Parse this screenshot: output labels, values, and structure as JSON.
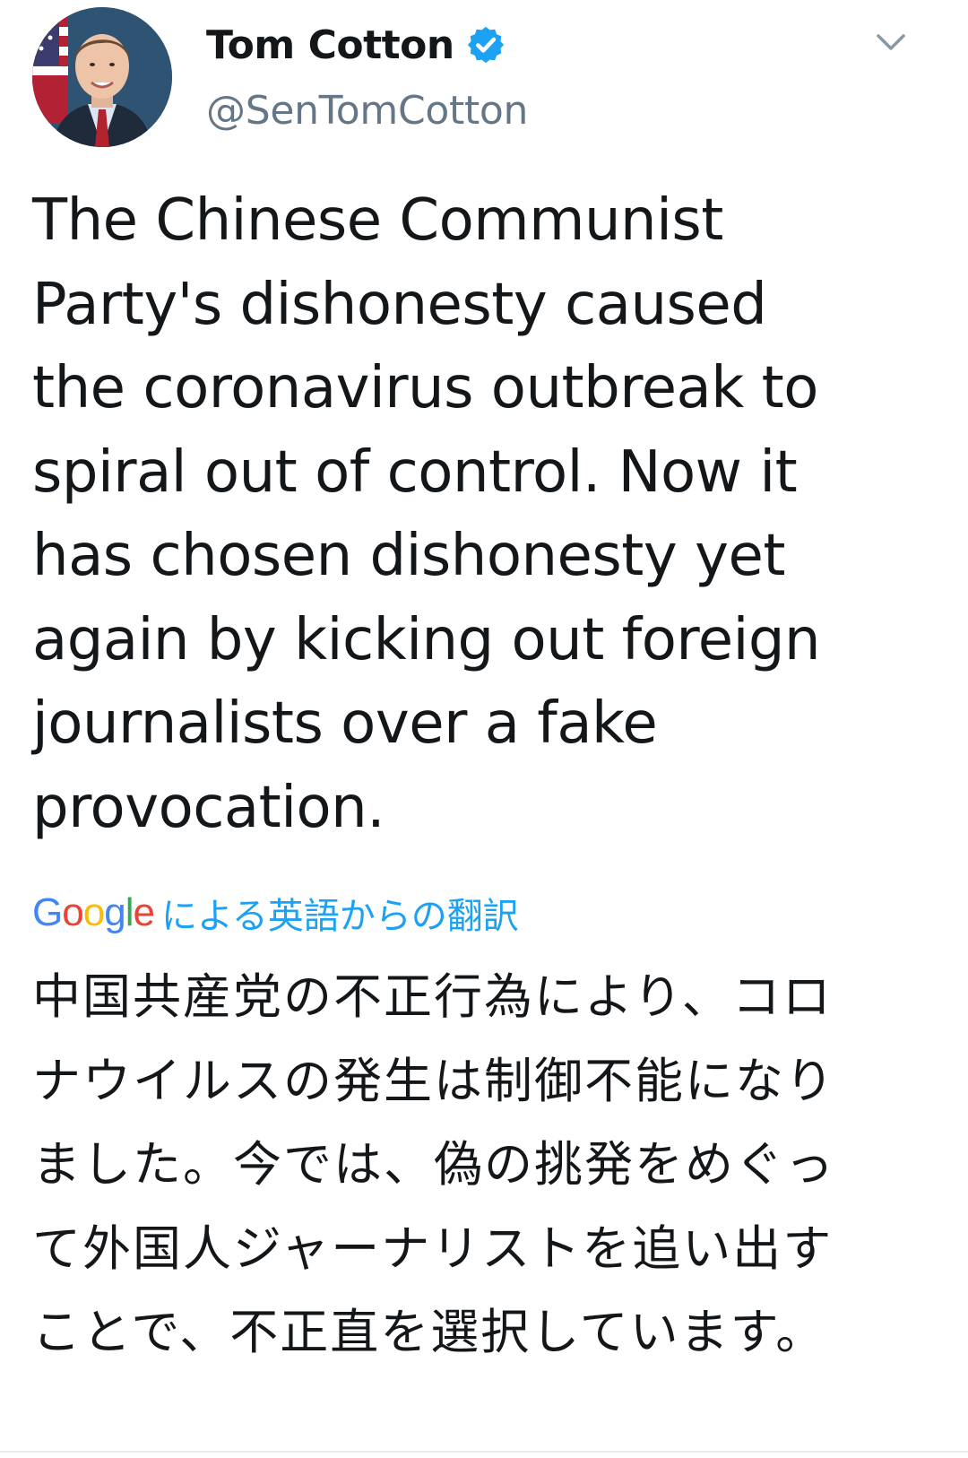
{
  "tweet": {
    "author": {
      "display_name": "Tom Cotton",
      "handle": "@SenTomCotton",
      "verified": true,
      "avatar_icon": "profile-photo"
    },
    "menu_icon": "chevron-down-icon",
    "text": "The Chinese Communist\nParty's dishonesty caused\nthe coronavirus outbreak to\nspiral out of control. Now it\nhas chosen dishonesty yet\nagain by kicking out foreign\njournalists over a fake\nprovocation.",
    "translation": {
      "provider_logo": "Google",
      "label": "による英語からの翻訳",
      "text": "中国共産党の不正行為により、コロ\nナウイルスの発生は制御不能になり\nました。今では、偽の挑発をめぐっ\nて外国人ジャーナリストを追い出す\nことで、不正直を選択しています。"
    }
  },
  "colors": {
    "verified_badge": "#1da1f2",
    "handle_gray": "#657786",
    "link_blue": "#1da1f2",
    "text": "#14171a",
    "google_blue": "#4285F4",
    "google_red": "#EA4335",
    "google_yellow": "#FBBC05",
    "google_green": "#34A853"
  }
}
